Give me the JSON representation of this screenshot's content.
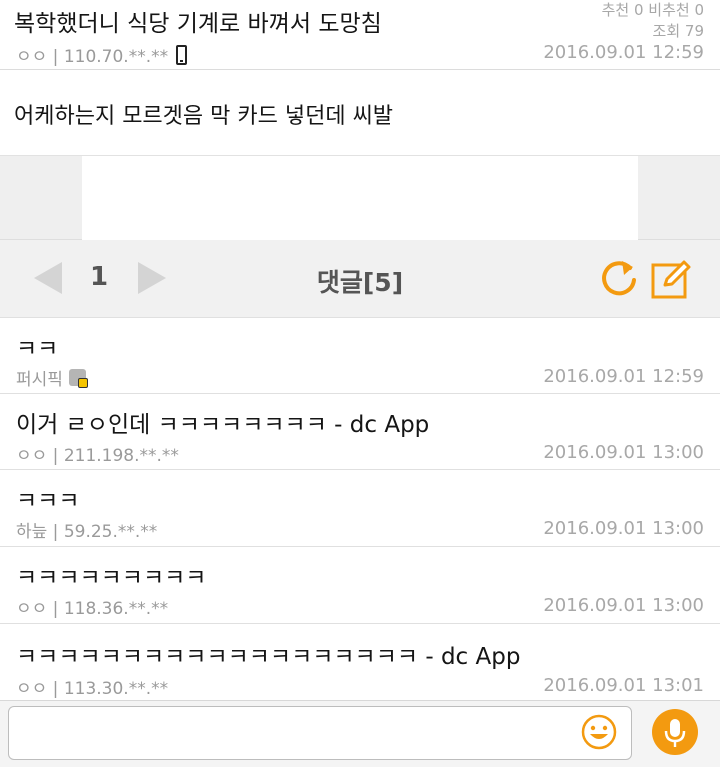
{
  "post": {
    "title": "복학했더니 식당 기계로 바껴서 도망침",
    "recommend": "추천 0 비추천 0",
    "views": "조회 79",
    "author": "ㅇㅇ | 110.70.**.**",
    "date": "2016.09.01 12:59",
    "body": "어케하는지 모르겟음 막 카드 넣던데 씨발"
  },
  "comment_bar": {
    "page": "1",
    "title": "댓글[5]"
  },
  "comments": [
    {
      "text": "ㅋㅋ",
      "author": "퍼시픽",
      "date": "2016.09.01 12:59",
      "badge": "gallery-badge-icon"
    },
    {
      "text": "이거 ㄹㅇ인데 ㅋㅋㅋㅋㅋㅋㅋㅋ  - dc App",
      "author": "ㅇㅇ | 211.198.**.**",
      "date": "2016.09.01 13:00"
    },
    {
      "text": "ㅋㅋㅋ",
      "author": "하늪 | 59.25.**.**",
      "date": "2016.09.01 13:00"
    },
    {
      "text": "ㅋㅋㅋㅋㅋㅋㅋㅋㅋ",
      "author": "ㅇㅇ | 118.36.**.**",
      "date": "2016.09.01 13:00"
    },
    {
      "text": "ㅋㅋㅋㅋㅋㅋㅋㅋㅋㅋㅋㅋㅋㅋㅋㅋㅋㅋㅋ  - dc App",
      "author": "ㅇㅇ | 113.30.**.**",
      "date": "2016.09.01 13:01"
    }
  ],
  "input": {
    "value": "",
    "placeholder": ""
  },
  "colors": {
    "accent": "#f39a10",
    "meta_text": "#9a9a9a",
    "bar_bg": "#f1f1f1"
  }
}
